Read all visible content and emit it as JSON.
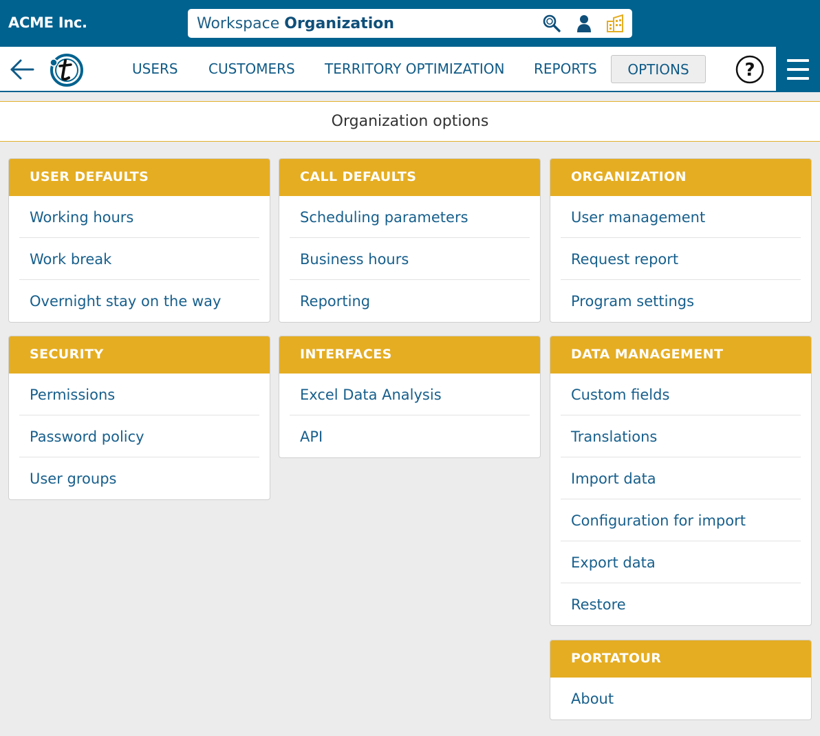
{
  "header": {
    "company": "ACME Inc.",
    "workspace_prefix": "Workspace",
    "workspace_name": "Organization"
  },
  "icons": {
    "search": "search-icon",
    "user": "user-icon",
    "building": "building-icon",
    "back": "back-arrow-icon",
    "logo": "portatour-logo-icon",
    "help": "help-icon",
    "menu": "hamburger-menu-icon"
  },
  "nav": {
    "items": [
      {
        "label": "USERS"
      },
      {
        "label": "CUSTOMERS"
      },
      {
        "label": "TERRITORY OPTIMIZATION"
      },
      {
        "label": "REPORTS"
      },
      {
        "label": "OPTIONS"
      }
    ],
    "active": "OPTIONS",
    "help_symbol": "?"
  },
  "page": {
    "title": "Organization options"
  },
  "cards": [
    {
      "title": "USER DEFAULTS",
      "items": [
        "Working hours",
        "Work break",
        "Overnight stay on the way"
      ]
    },
    {
      "title": "CALL DEFAULTS",
      "items": [
        "Scheduling parameters",
        "Business hours",
        "Reporting"
      ]
    },
    {
      "title": "ORGANIZATION",
      "items": [
        "User management",
        "Request report",
        "Program settings"
      ]
    },
    {
      "title": "SECURITY",
      "items": [
        "Permissions",
        "Password policy",
        "User groups"
      ]
    },
    {
      "title": "INTERFACES",
      "items": [
        "Excel Data Analysis",
        "API"
      ]
    },
    {
      "title": "DATA MANAGEMENT",
      "items": [
        "Custom fields",
        "Translations",
        "Import data",
        "Configuration for import",
        "Export data",
        "Restore"
      ]
    },
    {
      "title": "PORTATOUR",
      "items": [
        "About"
      ]
    }
  ],
  "colors": {
    "primary": "#00628f",
    "accent": "#e5ad22",
    "link": "#175f8c",
    "background": "#ececec"
  }
}
